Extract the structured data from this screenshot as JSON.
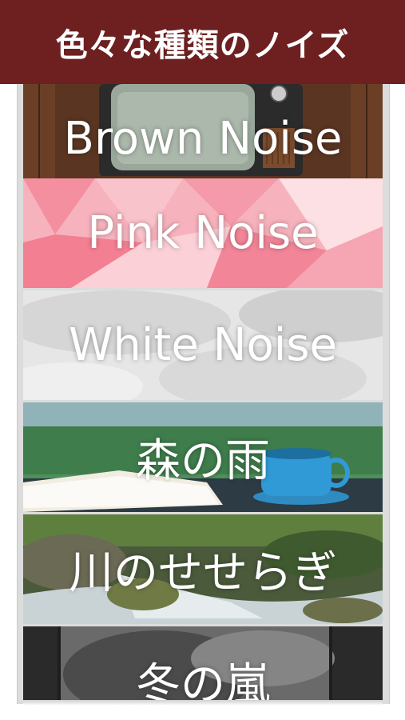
{
  "header": {
    "title": "色々な種類のノイズ"
  },
  "items": [
    {
      "label": "Brown Noise",
      "image": "vintage-tv-static"
    },
    {
      "label": "Pink Noise",
      "image": "pink-polygon-pattern"
    },
    {
      "label": "White Noise",
      "image": "gray-watercolor-texture"
    },
    {
      "label": "森の雨",
      "image": "rainy-window-book-coffee"
    },
    {
      "label": "川のせせらぎ",
      "image": "forest-stream"
    },
    {
      "label": "冬の嵐",
      "image": "winter-storm-window"
    }
  ],
  "colors": {
    "header": "#6e1f1f",
    "label": "#ffffff"
  }
}
